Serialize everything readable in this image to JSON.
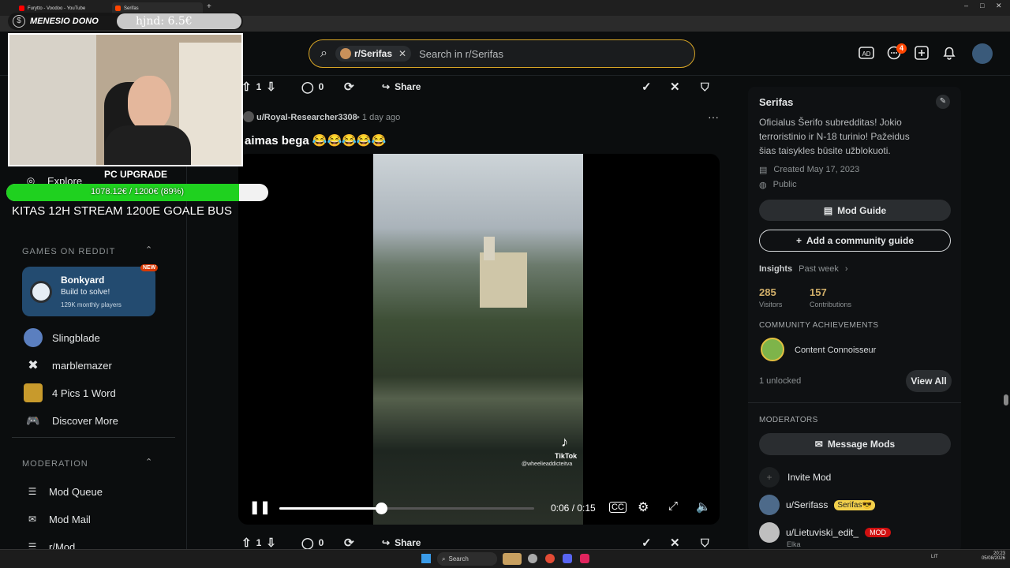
{
  "browser": {
    "tabs": [
      {
        "title": "Furytto - Voodoo - YouTube",
        "fav_color": "#ff0000"
      },
      {
        "title": "Serifas",
        "fav_color": "#ff4500"
      }
    ]
  },
  "stream_overlay": {
    "donation_label": "MENESIO DONO",
    "donation_value": "hjnd: 6.5€",
    "goal_title": "PC UPGRADE",
    "goal_progress_text": "1078.12€ / 1200€ (89%)",
    "goal_fraction": 0.89,
    "goal_subtitle": "KITAS 12H STREAM 1200E GOALE BUS"
  },
  "header": {
    "search_chip": "r/Serifas",
    "search_placeholder": "Search in r/Serifas",
    "notif_count": "4"
  },
  "sidebar": {
    "explore": "Explore",
    "games_title": "GAMES ON REDDIT",
    "featured_game": {
      "name": "Bonkyard",
      "tagline": "Build to solve!",
      "players": "129K monthly players",
      "badge": "NEW"
    },
    "games": [
      "Slingblade",
      "marblemazer",
      "4 Pics 1 Word",
      "Discover More"
    ],
    "moderation_title": "MODERATION",
    "mod_items": [
      "Mod Queue",
      "Mod Mail",
      "r/Mod"
    ]
  },
  "post": {
    "vote_count": "1",
    "comment_count": "0",
    "share_label": "Share",
    "author": "u/Royal-Researcher3308",
    "time": "• 1 day ago",
    "title": "aimas bega 😂😂😂😂😂",
    "video": {
      "time": "0:06 / 0:15",
      "progress": 0.4,
      "watermark": "TikTok",
      "watermark_user": "@wheelieaddicteitva"
    },
    "bottom_vote_count": "1",
    "bottom_comment_count": "0"
  },
  "community": {
    "name": "Serifas",
    "description": "Oficialus Šerifo subredditas! Jokio terroristinio ir N-18 turinio! Pažeidus šias taisykles būsite užblokuoti.",
    "created": "Created May 17, 2023",
    "visibility": "Public",
    "mod_guide": "Mod Guide",
    "add_guide": "Add a community guide",
    "insights_label": "Insights",
    "insights_period": "Past week",
    "visitors": "285",
    "visitors_label": "Visitors",
    "contributions": "157",
    "contributions_label": "Contributions",
    "achievements_title": "COMMUNITY ACHIEVEMENTS",
    "achievement": "Content Connoisseur",
    "unlocked": "1 unlocked",
    "view_all": "View All",
    "moderators_title": "MODERATORS",
    "message_mods": "Message Mods",
    "invite_mod": "Invite Mod",
    "mods": [
      {
        "name": "u/Serifass",
        "flair": "Serifas😎"
      },
      {
        "name": "u/Lietuviski_edit_",
        "flair": "MOD",
        "sub": "Elka"
      }
    ]
  },
  "taskbar": {
    "search": "Search",
    "lang": "LIT",
    "time": "20:23",
    "date": "05/08/2026"
  }
}
